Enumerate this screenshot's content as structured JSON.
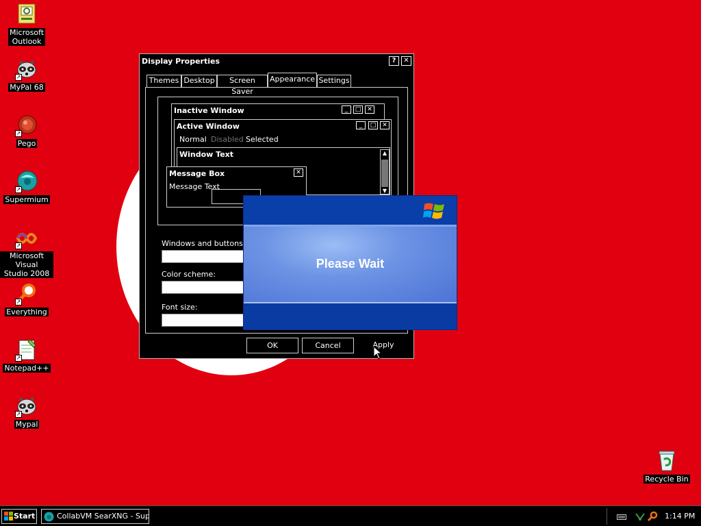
{
  "desktop": {
    "icons": [
      {
        "label": "Microsoft\nOutlook",
        "icon": "outlook-icon"
      },
      {
        "label": "MyPal 68",
        "icon": "raccoon-icon"
      },
      {
        "label": "Pego",
        "icon": "pego-icon"
      },
      {
        "label": "Supermium",
        "icon": "supermium-icon"
      },
      {
        "label": "Microsoft Visual\nStudio 2008",
        "icon": "visual-studio-icon"
      },
      {
        "label": "Everything",
        "icon": "magnifier-icon"
      },
      {
        "label": "Notepad++",
        "icon": "notepadpp-icon"
      },
      {
        "label": "Mypal",
        "icon": "raccoon-icon"
      },
      {
        "label": "Recycle Bin",
        "icon": "recycle-bin-icon"
      }
    ]
  },
  "dialog": {
    "title": "Display Properties",
    "help_glyph": "?",
    "close_glyph": "✕",
    "tabs": [
      "Themes",
      "Desktop",
      "Screen Saver",
      "Appearance",
      "Settings"
    ],
    "active_tab": "Appearance",
    "preview": {
      "inactive_title": "Inactive Window",
      "active_title": "Active Window",
      "menu": [
        "Normal",
        "Disabled",
        "Selected"
      ],
      "window_text": "Window Text",
      "msgbox_title": "Message Box",
      "msgbox_text": "Message Text"
    },
    "fields": {
      "windows_buttons_label": "Windows and buttons:",
      "color_scheme_label": "Color scheme:",
      "font_size_label": "Font size:"
    },
    "buttons": {
      "ok": "OK",
      "cancel": "Cancel",
      "apply": "Apply"
    }
  },
  "please_wait": {
    "text": "Please Wait"
  },
  "taskbar": {
    "start_label": "Start",
    "task_label": "CollabVM SearXNG - Sup...",
    "clock": "1:14 PM"
  },
  "colors": {
    "wallpaper": "#e0000f",
    "dialog_bg": "#000000",
    "xp_blue": "#0a3ea8"
  }
}
